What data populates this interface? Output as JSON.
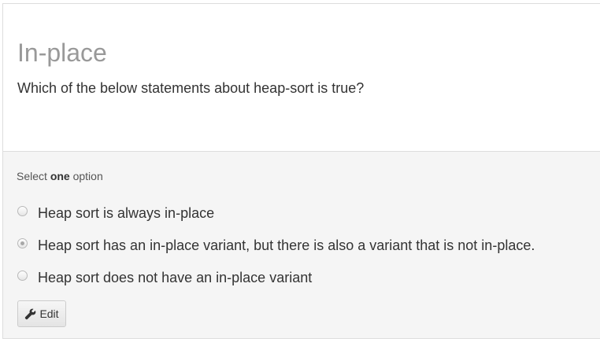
{
  "question": {
    "title": "In-place",
    "prompt": "Which of the below statements about heap-sort is true?"
  },
  "answer": {
    "instruction_prefix": "Select ",
    "instruction_emphasis": "one",
    "instruction_suffix": " option",
    "options": [
      {
        "label": "Heap sort is always in-place",
        "selected": false
      },
      {
        "label": "Heap sort has an in-place variant, but there is also a variant that is not in-place.",
        "selected": true
      },
      {
        "label": "Heap sort does not have an in-place variant",
        "selected": false
      }
    ],
    "edit_label": "Edit",
    "edit_icon": "wrench-icon"
  }
}
